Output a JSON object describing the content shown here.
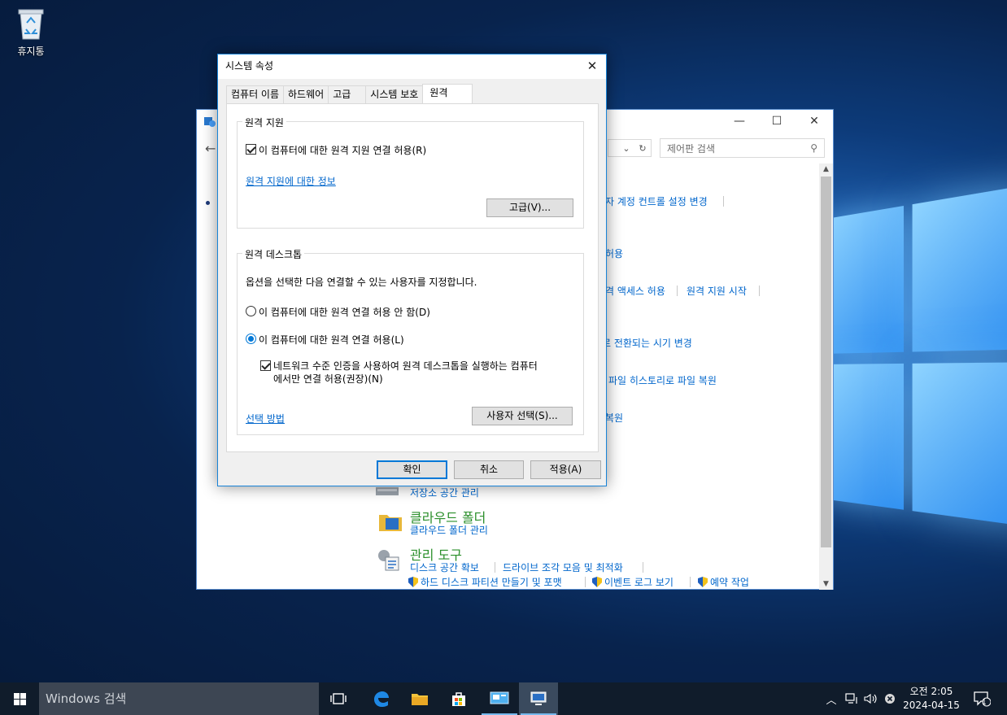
{
  "desktop": {
    "recycle_bin_label": "휴지통"
  },
  "control_panel": {
    "search_placeholder": "제어판 검색",
    "links": {
      "uac": "자 계정 컨트롤 설정 변경",
      "allow": "허용",
      "remote_access": "격 액세스 허용",
      "remote_assist_start": "원격 지원 시작",
      "sleep_change": "로 전환되는 시기 변경",
      "file_history": "파일 히스토리로 파일 복원",
      "restore": "복원",
      "storage": "저장소 공간 관리",
      "cloud_manage": "클라우드 폴더 관리",
      "disk_space": "디스크 공간 확보",
      "defrag": "드라이브 조각 모음 및 최적화",
      "partition": "하드 디스크 파티션 만들기 및 포맷",
      "event_log": "이벤트 로그 보기",
      "schedule": "예약 작업"
    },
    "headings": {
      "cloud_folder": "클라우드 폴더",
      "admin_tools": "관리 도구"
    }
  },
  "dialog": {
    "title": "시스템 속성",
    "tabs": [
      "컴퓨터 이름",
      "하드웨어",
      "고급",
      "시스템 보호",
      "원격"
    ],
    "remote_assistance": {
      "group_label": "원격 지원",
      "allow_checkbox": "이 컴퓨터에 대한 원격 지원 연결 허용(R)",
      "info_link": "원격 지원에 대한 정보",
      "advanced_button": "고급(V)..."
    },
    "remote_desktop": {
      "group_label": "원격 데스크톱",
      "description": "옵션을 선택한 다음 연결할 수 있는 사용자를 지정합니다.",
      "option_deny": "이 컴퓨터에 대한 원격 연결 허용 안 함(D)",
      "option_allow": "이 컴퓨터에 대한 원격 연결 허용(L)",
      "nla_line1": "네트워크 수준 인증을 사용하여 원격 데스크톱을 실행하는 컴퓨터",
      "nla_line2": "에서만 연결 허용(권장)(N)",
      "help_link": "선택 방법",
      "select_users_button": "사용자 선택(S)..."
    },
    "buttons": {
      "ok": "확인",
      "cancel": "취소",
      "apply": "적용(A)"
    }
  },
  "taskbar": {
    "search_placeholder": "Windows 검색",
    "clock_time": "오전 2:05",
    "clock_date": "2024-04-15",
    "notification_count": "1"
  }
}
